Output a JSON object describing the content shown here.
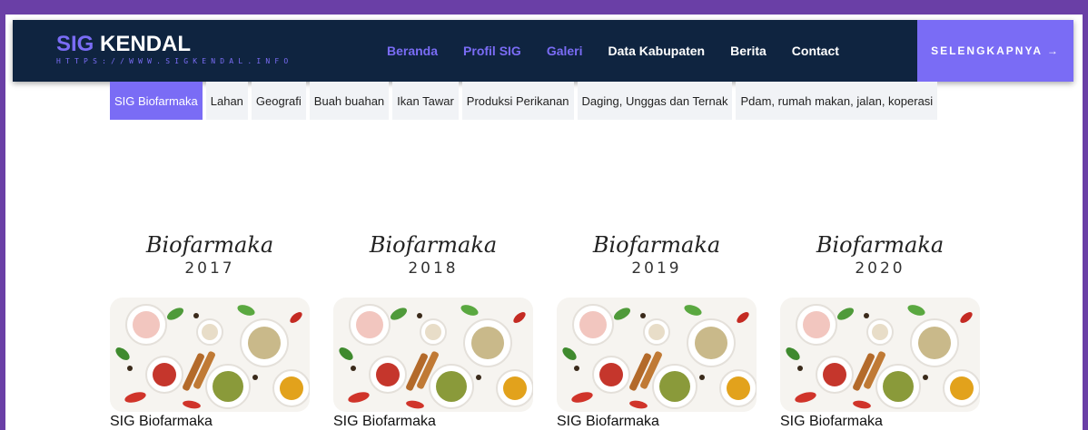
{
  "brand": {
    "name_part1": "SIG",
    "name_part2": "KENDAL",
    "url": "HTTPS://WWW.SIGKENDAL.INFO"
  },
  "nav": {
    "items": [
      {
        "label": "Beranda",
        "accent": true
      },
      {
        "label": "Profil SIG",
        "accent": true
      },
      {
        "label": "Galeri",
        "accent": true
      },
      {
        "label": "Data Kabupaten",
        "accent": false
      },
      {
        "label": "Berita",
        "accent": false
      },
      {
        "label": "Contact",
        "accent": false
      }
    ],
    "cta_label": "SELENGKAPNYA →"
  },
  "tabs": [
    {
      "label": "SIG Biofarmaka",
      "active": true
    },
    {
      "label": "Lahan",
      "active": false
    },
    {
      "label": "Geografi",
      "active": false
    },
    {
      "label": "Buah buahan",
      "active": false
    },
    {
      "label": "Ikan Tawar",
      "active": false
    },
    {
      "label": "Produksi Perikanan",
      "active": false
    },
    {
      "label": "Daging, Unggas dan Ternak",
      "active": false
    },
    {
      "label": "Pdam, rumah makan, jalan, koperasi",
      "active": false
    }
  ],
  "cards": [
    {
      "script": "Biofarmaka",
      "year": "2017",
      "title": "SIG Biofarmaka"
    },
    {
      "script": "Biofarmaka",
      "year": "2018",
      "title": "SIG Biofarmaka"
    },
    {
      "script": "Biofarmaka",
      "year": "2019",
      "title": "SIG Biofarmaka"
    },
    {
      "script": "Biofarmaka",
      "year": "2020",
      "title": "SIG Biofarmaka"
    }
  ],
  "colors": {
    "frame": "#6a3fa6",
    "navbar": "#0f2440",
    "accent": "#7a6cf5",
    "tab_bg": "#f1f3f6"
  }
}
